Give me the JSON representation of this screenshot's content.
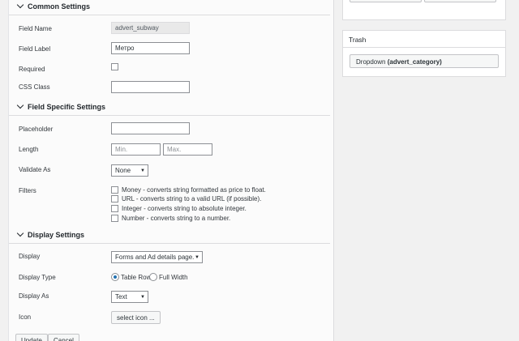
{
  "common": {
    "title": "Common Settings",
    "field_name_label": "Field Name",
    "field_name_value": "advert_subway",
    "field_label_label": "Field Label",
    "field_label_value": "Метро",
    "required_label": "Required",
    "css_class_label": "CSS Class",
    "css_class_value": ""
  },
  "specific": {
    "title": "Field Specific Settings",
    "placeholder_label": "Placeholder",
    "placeholder_value": "",
    "length_label": "Length",
    "length_min_placeholder": "Min.",
    "length_max_placeholder": "Max.",
    "validate_label": "Validate As",
    "validate_value": "None",
    "filters_label": "Filters",
    "filters": [
      "Money - converts string formatted as price to float.",
      "URL - converts string to a valid URL (if possible).",
      "Integer - converts string to absolute integer.",
      "Number - converts string to a number."
    ]
  },
  "display": {
    "title": "Display Settings",
    "display_label": "Display",
    "display_value": "Forms and Ad details page.",
    "display_type_label": "Display Type",
    "display_type_options": [
      "Table Row",
      "Full Width"
    ],
    "display_type_selected": "Table Row",
    "display_as_label": "Display As",
    "display_as_value": "Text",
    "icon_label": "Icon",
    "icon_button": "select icon ..."
  },
  "buttons": {
    "update": "Update",
    "cancel": "Cancel"
  },
  "trash": {
    "title": "Trash",
    "item_type": "Dropdown",
    "item_name": "(advert_category)"
  },
  "icons": {
    "chevron": "chevron-down-icon",
    "select_arrow": "▼"
  }
}
